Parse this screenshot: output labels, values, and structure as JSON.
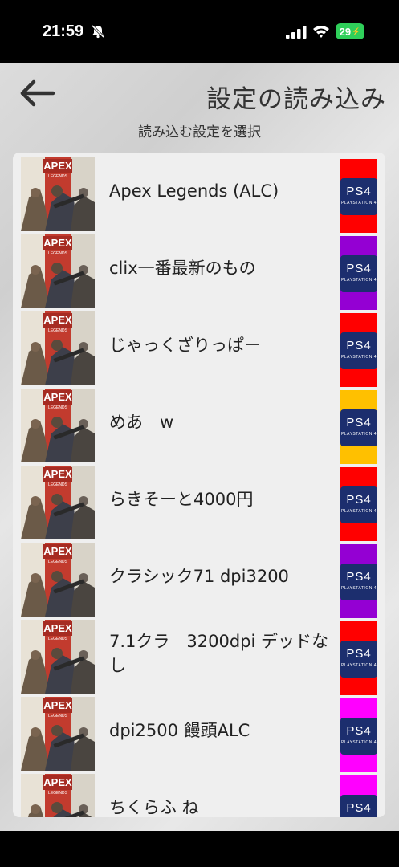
{
  "status_bar": {
    "time": "21:59",
    "battery": "29"
  },
  "header": {
    "title": "設定の読み込み",
    "subtitle": "読み込む設定を選択"
  },
  "ps4": {
    "label": "PS4",
    "sub": "PLAYSTATION 4"
  },
  "thumb": {
    "logo_top": "APEX",
    "logo_bottom": "LEGENDS"
  },
  "items": [
    {
      "label": "Apex Legends (ALC)",
      "color": "#ff0000"
    },
    {
      "label": "clix一番最新のもの",
      "color": "#9400d3"
    },
    {
      "label": "じゃっくざりっぱー",
      "color": "#ff0000"
    },
    {
      "label": "めあ　w",
      "color": "#ffc000"
    },
    {
      "label": "らきそーと4000円",
      "color": "#ff0000"
    },
    {
      "label": "クラシック71 dpi3200",
      "color": "#9400d3"
    },
    {
      "label": "7.1クラ　3200dpi デッドなし",
      "color": "#ff0000"
    },
    {
      "label": "dpi2500 饅頭ALC",
      "color": "#ff00ff"
    },
    {
      "label": "ちくらふ ね",
      "color": "#ff00ff"
    }
  ]
}
